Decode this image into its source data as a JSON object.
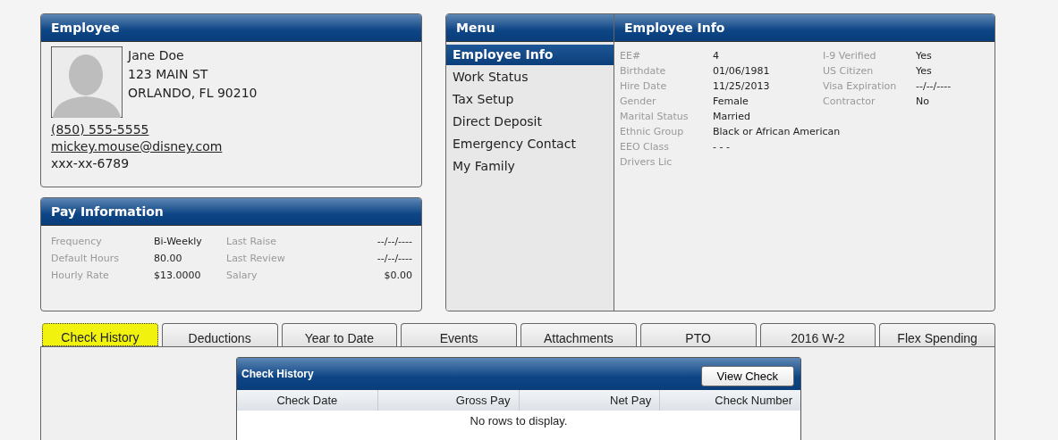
{
  "employee": {
    "title": "Employee",
    "name": "Jane Doe",
    "address_line_1": "123 MAIN ST",
    "address_line_2": "ORLANDO, FL 90210",
    "phone": "(850) 555-5555",
    "email": "mickey.mouse@disney.com",
    "ssn": "xxx-xx-6789"
  },
  "pay_information": {
    "title": "Pay Information",
    "fields": [
      {
        "label": "Frequency",
        "value": "Bi-Weekly"
      },
      {
        "label": "Last Raise",
        "value": "--/--/----"
      },
      {
        "label": "Default Hours",
        "value": "80.00"
      },
      {
        "label": "Last Review",
        "value": "--/--/----"
      },
      {
        "label": "Hourly Rate",
        "value": "$13.0000"
      },
      {
        "label": "Salary",
        "value": "$0.00"
      }
    ]
  },
  "menu": {
    "title": "Menu",
    "items": [
      {
        "label": "Employee Info",
        "selected": true
      },
      {
        "label": "Work Status",
        "selected": false
      },
      {
        "label": "Tax Setup",
        "selected": false
      },
      {
        "label": "Direct Deposit",
        "selected": false
      },
      {
        "label": "Emergency Contact",
        "selected": false
      },
      {
        "label": "My Family",
        "selected": false
      }
    ]
  },
  "employee_info": {
    "title": "Employee Info",
    "left_fields": [
      {
        "label": "EE#",
        "value": "4"
      },
      {
        "label": "Birthdate",
        "value": "01/06/1981"
      },
      {
        "label": "Hire Date",
        "value": "11/25/2013"
      },
      {
        "label": "Gender",
        "value": "Female"
      },
      {
        "label": "Marital Status",
        "value": "Married"
      },
      {
        "label": "Ethnic Group",
        "value": "Black or African American"
      },
      {
        "label": "EEO Class",
        "value": "- - -"
      },
      {
        "label": "Drivers Lic"
      }
    ],
    "right_fields": [
      {
        "label": "I-9 Verified",
        "value": "Yes"
      },
      {
        "label": "US Citizen",
        "value": "Yes"
      },
      {
        "label": "Visa Expiration",
        "value": "--/--/----"
      },
      {
        "label": "Contractor",
        "value": "No"
      }
    ]
  },
  "tabs": [
    {
      "label": "Check History",
      "selected": true
    },
    {
      "label": "Deductions",
      "selected": false
    },
    {
      "label": "Year to Date",
      "selected": false
    },
    {
      "label": "Events",
      "selected": false
    },
    {
      "label": "Attachments",
      "selected": false
    },
    {
      "label": "PTO",
      "selected": false
    },
    {
      "label": "2016 W-2",
      "selected": false
    },
    {
      "label": "Flex Spending",
      "selected": false
    }
  ],
  "check_history": {
    "title": "Check History",
    "button": "View Check",
    "columns": [
      "Check Date",
      "Gross Pay",
      "Net Pay",
      "Check Number"
    ],
    "empty_message": "No rows to display."
  }
}
